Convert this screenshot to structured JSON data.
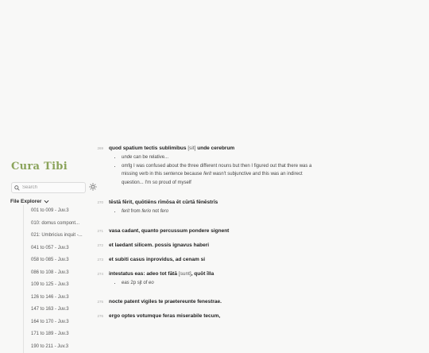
{
  "app": {
    "title": "Cura Tibi"
  },
  "search": {
    "placeholder": "Search",
    "value": ""
  },
  "explorer": {
    "title": "File Explorer",
    "files": [
      "001 to 009 - Juv.3",
      "010: domus compont...",
      "021: Umbricius inquit -...",
      "041 to 057 - Juv.3",
      "058 to 085 - Juv.3",
      "086 to 108 - Juv.3",
      "109 to 125 - Juv.3",
      "126 to 146 - Juv.3",
      "147 to 163 - Juv.3",
      "164 to 170 - Juv.3",
      "171 to 189 - Juv.3",
      "190 to 211 - Juv.3"
    ]
  },
  "lines": [
    {
      "num": "269",
      "pre": "quod spatium tectis sublimibus ",
      "bracket": "[sit]",
      "post": " unde cerebrum",
      "notes": [
        {
          "parts": [
            {
              "t": "unde",
              "i": true
            },
            {
              "t": " can be relative..."
            }
          ]
        },
        {
          "parts": [
            {
              "t": "omfg I was confused about the three different nouns but then I figured out that there was a missing verb in this sentence because "
            },
            {
              "t": "ferit",
              "i": true
            },
            {
              "t": " wasn't subjunctive and this was an indirect question... I'm so proud of myself"
            }
          ]
        }
      ]
    },
    {
      "num": "270",
      "pre": "tēstā fērit, quōtiēns rīmōsa ēt cūrtā fēnēstrīs",
      "bracket": "",
      "post": "",
      "notes": [
        {
          "parts": [
            {
              "t": "ferit",
              "i": true
            },
            {
              "t": " from "
            },
            {
              "t": "ferio",
              "i": true
            },
            {
              "t": " not "
            },
            {
              "t": "fero",
              "i": true
            }
          ]
        }
      ]
    },
    {
      "num": "271",
      "pre": "vasa cadant, quanto percussum pondere signent",
      "bracket": "",
      "post": "",
      "notes": []
    },
    {
      "num": "272",
      "pre": "et laedant silicem. possis ignavus haberi",
      "bracket": "",
      "post": "",
      "notes": []
    },
    {
      "num": "273",
      "pre": "et subiti casus inprovidus, ad cenam si",
      "bracket": "",
      "post": "",
      "notes": []
    },
    {
      "num": "274",
      "pre": "intestatus eas: adeo tot fātā ",
      "bracket": "[sunt]",
      "post": ", quōt īlla",
      "notes": [
        {
          "parts": [
            {
              "t": "eas",
              "i": true
            },
            {
              "t": " 2p sjt of "
            },
            {
              "t": "eo",
              "i": true
            }
          ]
        }
      ]
    },
    {
      "num": "275",
      "pre": "nocte patent vigiles te praetereunte fenestrae.",
      "bracket": "",
      "post": "",
      "notes": []
    },
    {
      "num": "276",
      "pre": "ergo optes votumque feras miserabile tecum,",
      "bracket": "",
      "post": "",
      "notes": []
    }
  ]
}
